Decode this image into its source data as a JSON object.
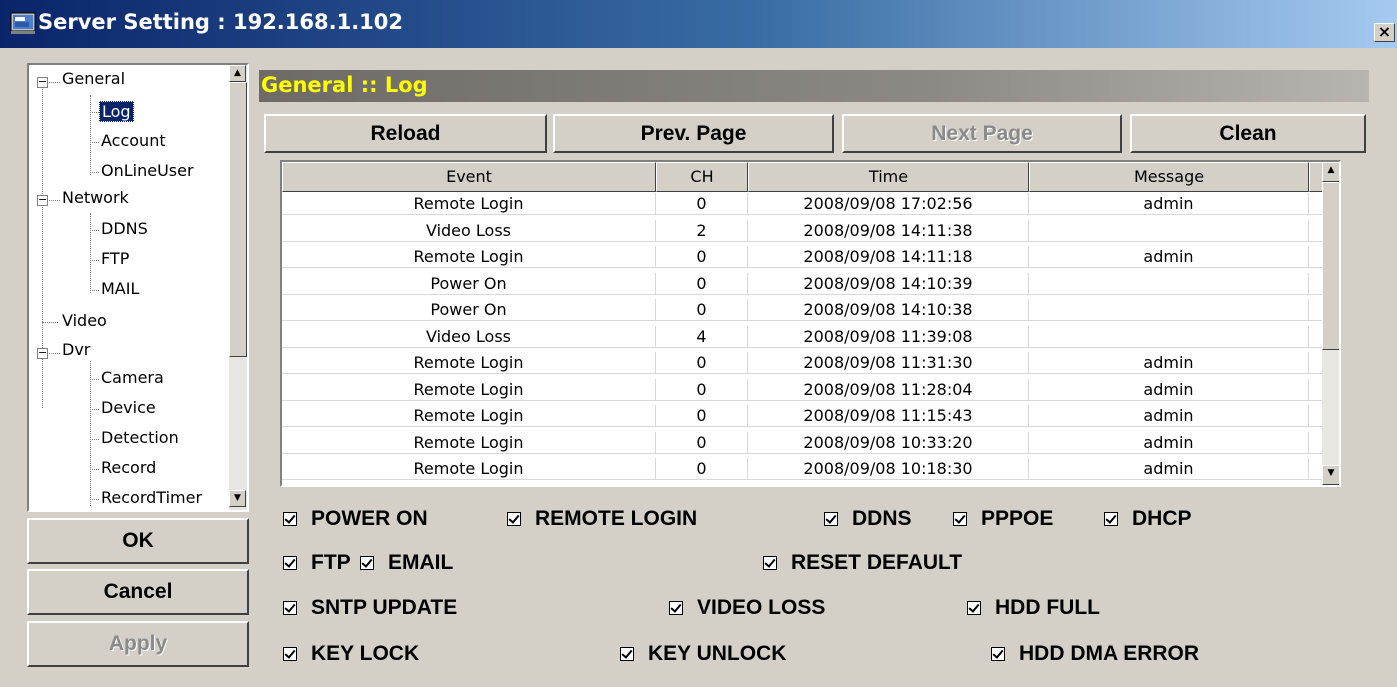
{
  "window": {
    "title": "Server Setting : 192.168.1.102",
    "close_label": "×"
  },
  "tree": {
    "items": [
      {
        "label": "General",
        "expander": "−"
      },
      {
        "label": "Log"
      },
      {
        "label": "Account"
      },
      {
        "label": "OnLineUser"
      },
      {
        "label": "Network",
        "expander": "−"
      },
      {
        "label": "DDNS"
      },
      {
        "label": "FTP"
      },
      {
        "label": "MAIL"
      },
      {
        "label": "Video"
      },
      {
        "label": "Dvr",
        "expander": "−"
      },
      {
        "label": "Camera"
      },
      {
        "label": "Device"
      },
      {
        "label": "Detection"
      },
      {
        "label": "Record"
      },
      {
        "label": "RecordTimer"
      }
    ],
    "selected": "Log"
  },
  "side_buttons": {
    "ok": "OK",
    "cancel": "Cancel",
    "apply": "Apply"
  },
  "section_title": "General :: Log",
  "toolbar": {
    "reload": "Reload",
    "prev": "Prev. Page",
    "next": "Next Page",
    "clean": "Clean"
  },
  "log_table": {
    "columns": [
      "Event",
      "CH",
      "Time",
      "Message"
    ],
    "rows": [
      [
        "Remote Login",
        "0",
        "2008/09/08 17:02:56",
        "admin"
      ],
      [
        "Video Loss",
        "2",
        "2008/09/08 14:11:38",
        ""
      ],
      [
        "Remote Login",
        "0",
        "2008/09/08 14:11:18",
        "admin"
      ],
      [
        "Power On",
        "0",
        "2008/09/08 14:10:39",
        ""
      ],
      [
        "Power On",
        "0",
        "2008/09/08 14:10:38",
        ""
      ],
      [
        "Video Loss",
        "4",
        "2008/09/08 11:39:08",
        ""
      ],
      [
        "Remote Login",
        "0",
        "2008/09/08 11:31:30",
        "admin"
      ],
      [
        "Remote Login",
        "0",
        "2008/09/08 11:28:04",
        "admin"
      ],
      [
        "Remote Login",
        "0",
        "2008/09/08 11:15:43",
        "admin"
      ],
      [
        "Remote Login",
        "0",
        "2008/09/08 10:33:20",
        "admin"
      ],
      [
        "Remote Login",
        "0",
        "2008/09/08 10:18:30",
        "admin"
      ]
    ]
  },
  "filters": {
    "power_on": "POWER ON",
    "remote_login": "REMOTE LOGIN",
    "ddns": "DDNS",
    "pppoe": "PPPOE",
    "dhcp": "DHCP",
    "ftp": "FTP",
    "email": "EMAIL",
    "reset_default": "RESET DEFAULT",
    "sntp_update": "SNTP UPDATE",
    "video_loss": "VIDEO LOSS",
    "hdd_full": "HDD FULL",
    "key_lock": "KEY LOCK",
    "key_unlock": "KEY UNLOCK",
    "hdd_dma_error": "HDD DMA ERROR"
  },
  "colors": {
    "title_bar": "#0a246a",
    "section_title_text": "#ffff00",
    "selected_item": "#0a246a",
    "face": "#d4d0c8"
  },
  "icons": {
    "app": "server-setting-icon",
    "scroll_up": "scroll-up-arrow-icon",
    "scroll_down": "scroll-down-arrow-icon"
  }
}
